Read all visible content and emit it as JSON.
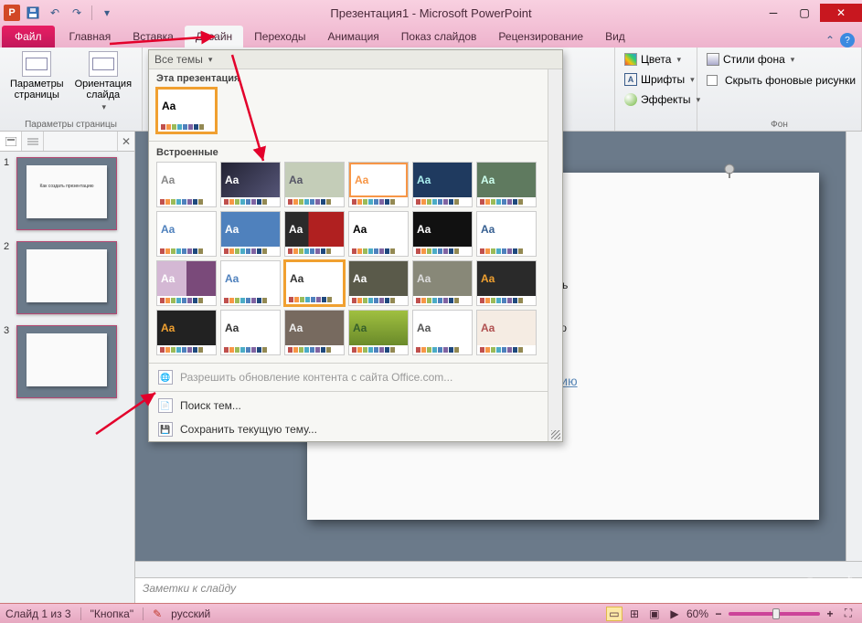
{
  "title": "Презентация1 - Microsoft PowerPoint",
  "app_letter": "P",
  "ribbon": {
    "file": "Файл",
    "tabs": [
      "Главная",
      "Вставка",
      "Дизайн",
      "Переходы",
      "Анимация",
      "Показ слайдов",
      "Рецензирование",
      "Вид"
    ],
    "active_tab": "Дизайн"
  },
  "page_setup_group": {
    "params": "Параметры\nстраницы",
    "orient": "Ориентация\nслайда",
    "label": "Параметры страницы"
  },
  "themes_dd": {
    "header": "Все темы",
    "sec1": "Эта презентация",
    "sec2": "Встроенные",
    "office_update": "Разрешить обновление контента с сайта Office.com...",
    "browse": "Поиск тем...",
    "save": "Сохранить текущую тему..."
  },
  "themes_right": {
    "colors": "Цвета",
    "fonts": "Шрифты",
    "effects": "Эффекты"
  },
  "bg_group": {
    "styles": "Стили фона",
    "hide": "Скрыть фоновые рисунки",
    "label": "Фон"
  },
  "slide": {
    "title_partial_1": "ть",
    "title_partial_2": "ю",
    "sub_partial": "твию",
    "thumb_title": "Как создать презентацию"
  },
  "notes_placeholder": "Заметки к слайду",
  "status": {
    "slide": "Слайд 1 из 3",
    "theme": "\"Кнопка\"",
    "lang": "русский",
    "zoom": "60%"
  },
  "watermark": "Club Sovet"
}
